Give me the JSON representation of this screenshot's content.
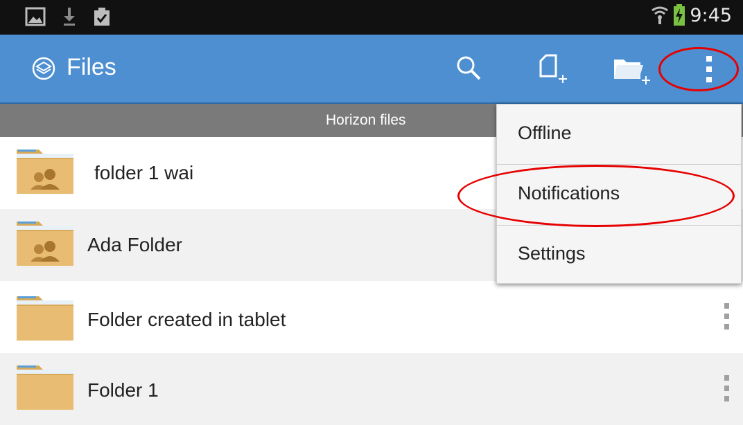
{
  "status_bar": {
    "time": "9:45",
    "icons": [
      "gallery-icon",
      "download-icon",
      "clipboard-check-icon",
      "wifi-icon",
      "battery-charging-icon"
    ]
  },
  "action_bar": {
    "title": "Files",
    "logo_icon": "layers-logo-icon",
    "actions": [
      "search-icon",
      "new-file-icon",
      "new-folder-icon",
      "overflow-menu-icon"
    ],
    "color": "#4d8fd0"
  },
  "tab_header": {
    "label": "Horizon files"
  },
  "list": {
    "items": [
      {
        "label": "folder 1 wai",
        "shared": true
      },
      {
        "label": "Ada Folder",
        "shared": true
      },
      {
        "label": "Folder created in tablet",
        "shared": false
      },
      {
        "label": "Folder 1",
        "shared": false
      }
    ]
  },
  "menu": {
    "items": [
      {
        "label": "Offline"
      },
      {
        "label": "Notifications"
      },
      {
        "label": "Settings"
      }
    ]
  },
  "annotation_color": "#e60000"
}
